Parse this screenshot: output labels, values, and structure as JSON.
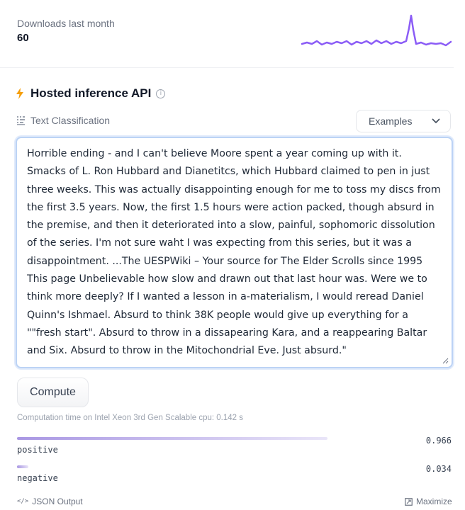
{
  "downloads": {
    "label": "Downloads last month",
    "count": "60"
  },
  "inference": {
    "title": "Hosted inference API",
    "task_label": "Text Classification",
    "examples_label": "Examples",
    "input_text": "Horrible ending - and I can't believe Moore spent a year coming up with it. Smacks of L. Ron Hubbard and Dianetitcs, which Hubbard claimed to pen in just three weeks. This was actually disappointing enough for me to toss my discs from the first 3.5 years. Now, the first 1.5 hours were action packed, though absurd in the premise, and then it deteriorated into a slow, painful, sophomoric dissolution of the series. I'm not sure waht I was expecting from this series, but it was a disappointment.  ...The UESPWiki – Your source for The Elder Scrolls since 1995 This page Unbelievable how slow and drawn out that last hour was. Were we to think more deeply? If I wanted a lesson in a-materialism, I would reread Daniel Quinn's Ishmael. Absurd to think 38K people would give up everything for a \"\"fresh start\". Absurd to throw in a dissapearing Kara, and a reappearing Baltar and Six. Absurd to throw in the Mitochondrial Eve. Just absurd.\"",
    "compute_label": "Compute",
    "computation_time": "Computation time on Intel Xeon 3rd Gen Scalable cpu: 0.142 s",
    "results": [
      {
        "label": "positive",
        "score": "0.966",
        "fraction": 0.966
      },
      {
        "label": "negative",
        "score": "0.034",
        "fraction": 0.034
      }
    ],
    "json_output_label": "JSON Output",
    "maximize_label": "Maximize"
  },
  "colors": {
    "sparkline": "#8b5cf6",
    "bolt": "#f59e0b",
    "input_border": "#bcd3f5"
  },
  "icons": {
    "bolt": "bolt-icon",
    "info": "info-icon",
    "task": "text-classification-icon",
    "chevron": "chevron-down-icon",
    "code": "code-icon",
    "maximize": "maximize-icon"
  }
}
